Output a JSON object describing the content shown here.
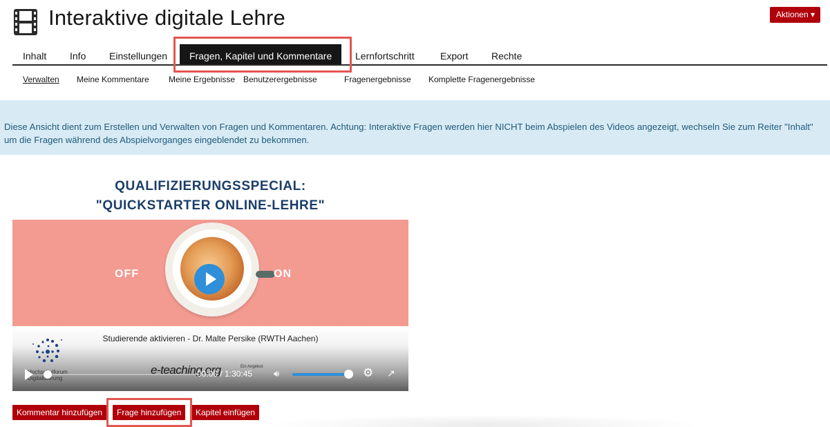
{
  "header": {
    "title": "Interaktive digitale Lehre",
    "actions_label": "Aktionen",
    "actions_caret": "▾",
    "icon": "film-icon"
  },
  "tabs": [
    {
      "label": "Inhalt"
    },
    {
      "label": "Info"
    },
    {
      "label": "Einstellungen"
    },
    {
      "label": "Fragen, Kapitel und Kommentare",
      "active": true
    },
    {
      "label": "Lernfortschritt"
    },
    {
      "label": "Export"
    },
    {
      "label": "Rechte"
    }
  ],
  "subtabs": [
    {
      "label": "Verwalten",
      "current": true
    },
    {
      "label": "Meine Kommentare"
    },
    {
      "label": "Meine Ergebnisse"
    },
    {
      "label": "Benutzerergebnisse"
    },
    {
      "label": "Fragenergebnisse"
    },
    {
      "label": "Komplette Fragenergebnisse"
    }
  ],
  "info_message": "Diese Ansicht dient zum Erstellen und Verwalten von Fragen und Kommentaren. Achtung: Interaktive Fragen werden hier NICHT beim Abspielen des Videos angezeigt, wechseln Sie zum Reiter \"Inhalt\" um die Fragen während des Abspielvorganges eingeblendet zu bekommen.",
  "video": {
    "title_line1": "QUALIFIZIERUNGSSPECIAL:",
    "title_line2": "\"QUICKSTARTER ONLINE-LEHRE\"",
    "off_label": "OFF",
    "on_label": "ON",
    "speaker": "Studierende aktivieren - Dr. Malte Persike (RWTH Aachen)",
    "logo_text_1": "Hochschulforum",
    "logo_text_2": "Digitalisierung",
    "eteaching": "e-teaching.org",
    "ein_angebot": "Ein Angebot",
    "current_time": "00:00",
    "time_separator": "/",
    "duration": "1:30:45",
    "volume_fraction": 1.0,
    "progress_fraction": 0.0,
    "colors": {
      "accent": "#2f8fd8",
      "thumbnail_bg": "#f39a91"
    }
  },
  "buttons": {
    "add_comment": "Kommentar hinzufügen",
    "add_question": "Frage hinzufügen",
    "insert_chapter": "Kapitel einfügen"
  },
  "colors": {
    "brand_red": "#b0000a",
    "info_bg": "#d8ebf5",
    "info_text": "#1f5a7b",
    "highlight": "#e4554f"
  }
}
